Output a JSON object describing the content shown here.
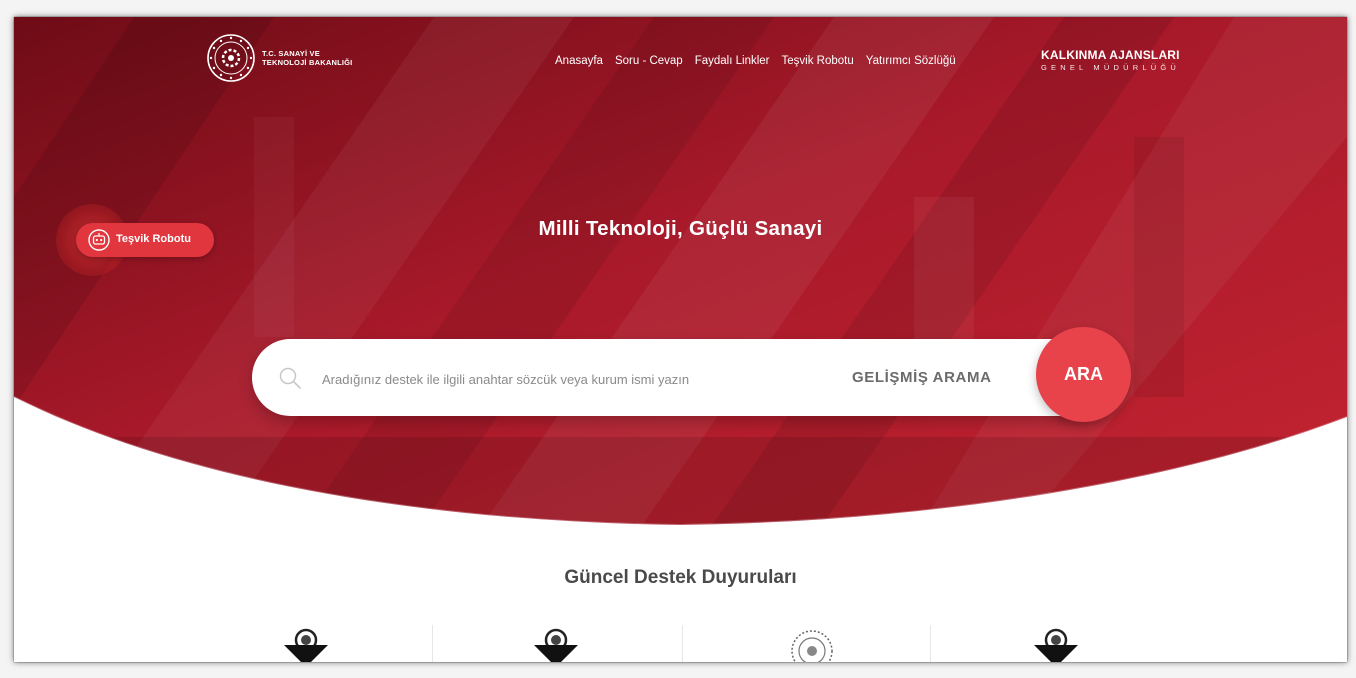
{
  "header": {
    "logo_line1": "T.C. SANAYİ VE",
    "logo_line2": "TEKNOLOJİ BAKANLIĞI",
    "nav": [
      "Anasayfa",
      "Soru - Cevap",
      "Faydalı Linkler",
      "Teşvik Robotu",
      "Yatırımcı Sözlüğü"
    ],
    "brand_title": "KALKINMA AJANSLARI",
    "brand_subtitle": "GENEL MÜDÜRLÜĞÜ"
  },
  "floating_button": {
    "label": "Teşvik Robotu",
    "icon": "robot-icon"
  },
  "hero": {
    "headline": "Milli Teknoloji, Güçlü Sanayi"
  },
  "search": {
    "placeholder": "Aradığınız destek ile ilgili anahtar sözcük veya kurum ismi yazın",
    "advanced_label": "GELİŞMİŞ ARAMA",
    "submit_label": "ARA"
  },
  "announcements": {
    "title": "Güncel Destek Duyuruları",
    "logos": [
      "agency-logo-icon",
      "agency-logo-icon",
      "ministry-seal-icon",
      "agency-logo-icon"
    ]
  },
  "colors": {
    "hero_dark": "#7a0f1a",
    "hero_red": "#c4222f",
    "accent": "#e8424a"
  }
}
